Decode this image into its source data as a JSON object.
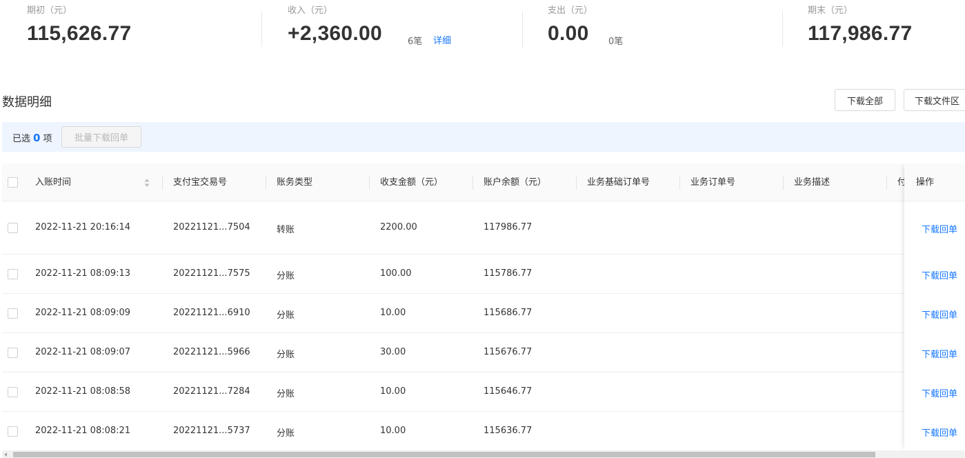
{
  "summary": {
    "opening": {
      "label": "期初（元）",
      "value": "115,626.77"
    },
    "income": {
      "label": "收入（元）",
      "value": "+2,360.00",
      "count": "6笔",
      "detail_link": "详细"
    },
    "expense": {
      "label": "支出（元）",
      "value": "0.00",
      "count": "0笔"
    },
    "closing": {
      "label": "期末（元）",
      "value": "117,986.77"
    }
  },
  "section": {
    "title": "数据明细",
    "download_all": "下载全部",
    "download_files": "下载文件区"
  },
  "selection": {
    "prefix": "已选",
    "count": "0",
    "suffix": "项",
    "batch_button": "批量下载回单"
  },
  "table": {
    "columns": [
      "入账时间",
      "支付宝交易号",
      "账务类型",
      "收支金额（元）",
      "账户余额（元）",
      "业务基础订单号",
      "业务订单号",
      "业务描述",
      "付"
    ],
    "operation_header": "操作",
    "rows": [
      {
        "time": "2022-11-21 20:16:14",
        "trade_no": "20221121...7504",
        "type": "转账",
        "amount": "2200.00",
        "balance": "117986.77",
        "action": "下载回单"
      },
      {
        "time": "2022-11-21 08:09:13",
        "trade_no": "20221121...7575",
        "type": "分账",
        "amount": "100.00",
        "balance": "115786.77",
        "action": "下载回单"
      },
      {
        "time": "2022-11-21 08:09:09",
        "trade_no": "20221121...6910",
        "type": "分账",
        "amount": "10.00",
        "balance": "115686.77",
        "action": "下载回单"
      },
      {
        "time": "2022-11-21 08:09:07",
        "trade_no": "20221121...5966",
        "type": "分账",
        "amount": "30.00",
        "balance": "115676.77",
        "action": "下载回单"
      },
      {
        "time": "2022-11-21 08:08:58",
        "trade_no": "20221121...7284",
        "type": "分账",
        "amount": "10.00",
        "balance": "115646.77",
        "action": "下载回单"
      },
      {
        "time": "2022-11-21 08:08:21",
        "trade_no": "20221121...5737",
        "type": "分账",
        "amount": "10.00",
        "balance": "115636.77",
        "action": "下载回单"
      }
    ]
  },
  "colors": {
    "link": "#1677ff",
    "selection_bar": "#eef5ff",
    "header_bg": "#fafafa"
  },
  "icons": {
    "sort": "sort-arrows-icon",
    "scroll_left": "arrow-left-icon"
  }
}
